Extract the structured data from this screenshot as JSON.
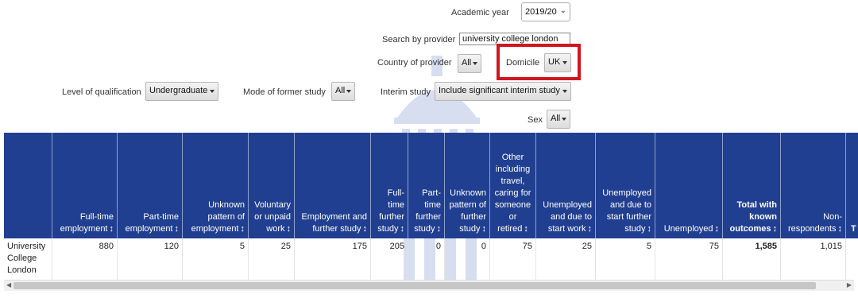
{
  "filters": {
    "academic_year": {
      "label": "Academic year",
      "value": "2019/20"
    },
    "search_provider": {
      "label": "Search by provider",
      "value": "university college london"
    },
    "country": {
      "label": "Country of provider",
      "value": "All"
    },
    "domicile": {
      "label": "Domicile",
      "value": "UK"
    },
    "level": {
      "label": "Level of qualification",
      "value": "Undergraduate"
    },
    "mode": {
      "label": "Mode of former study",
      "value": "All"
    },
    "interim": {
      "label": "Interim study",
      "value": "Include significant interim study"
    },
    "sex": {
      "label": "Sex",
      "value": "All"
    }
  },
  "colors": {
    "header_bg": "#213f90",
    "highlight": "#d0161f"
  },
  "icons": {
    "sort": "↕",
    "dropdown": "caret-down"
  },
  "table": {
    "columns": [
      {
        "label": "",
        "sort": ""
      },
      {
        "label": "Full-time employment",
        "sort": "↕"
      },
      {
        "label": "Part-time employment",
        "sort": "↕"
      },
      {
        "label": "Unknown pattern of employment",
        "sort": "↕"
      },
      {
        "label": "Voluntary or unpaid work",
        "sort": "↕"
      },
      {
        "label": "Employment and further study",
        "sort": "↕"
      },
      {
        "label": "Full-time further study",
        "sort": "↕"
      },
      {
        "label": "Part-time further study",
        "sort": "↕"
      },
      {
        "label": "Unknown pattern of further study",
        "sort": "↕"
      },
      {
        "label": "Other including travel, caring for someone or retired",
        "sort": "↕"
      },
      {
        "label": "Unemployed and due to start work",
        "sort": "↕"
      },
      {
        "label": "Unemployed and due to start further study",
        "sort": "↕"
      },
      {
        "label": "Unemployed",
        "sort": "↕"
      },
      {
        "label": "Total with known outcomes",
        "sort": "↕"
      },
      {
        "label": "Non-respondents",
        "sort": "↕"
      },
      {
        "label": "T",
        "sort": ""
      }
    ],
    "rows": [
      [
        "University College London",
        "880",
        "120",
        "5",
        "25",
        "175",
        "205",
        "0",
        "0",
        "75",
        "25",
        "5",
        "75",
        "1,585",
        "1,015",
        ""
      ]
    ]
  }
}
